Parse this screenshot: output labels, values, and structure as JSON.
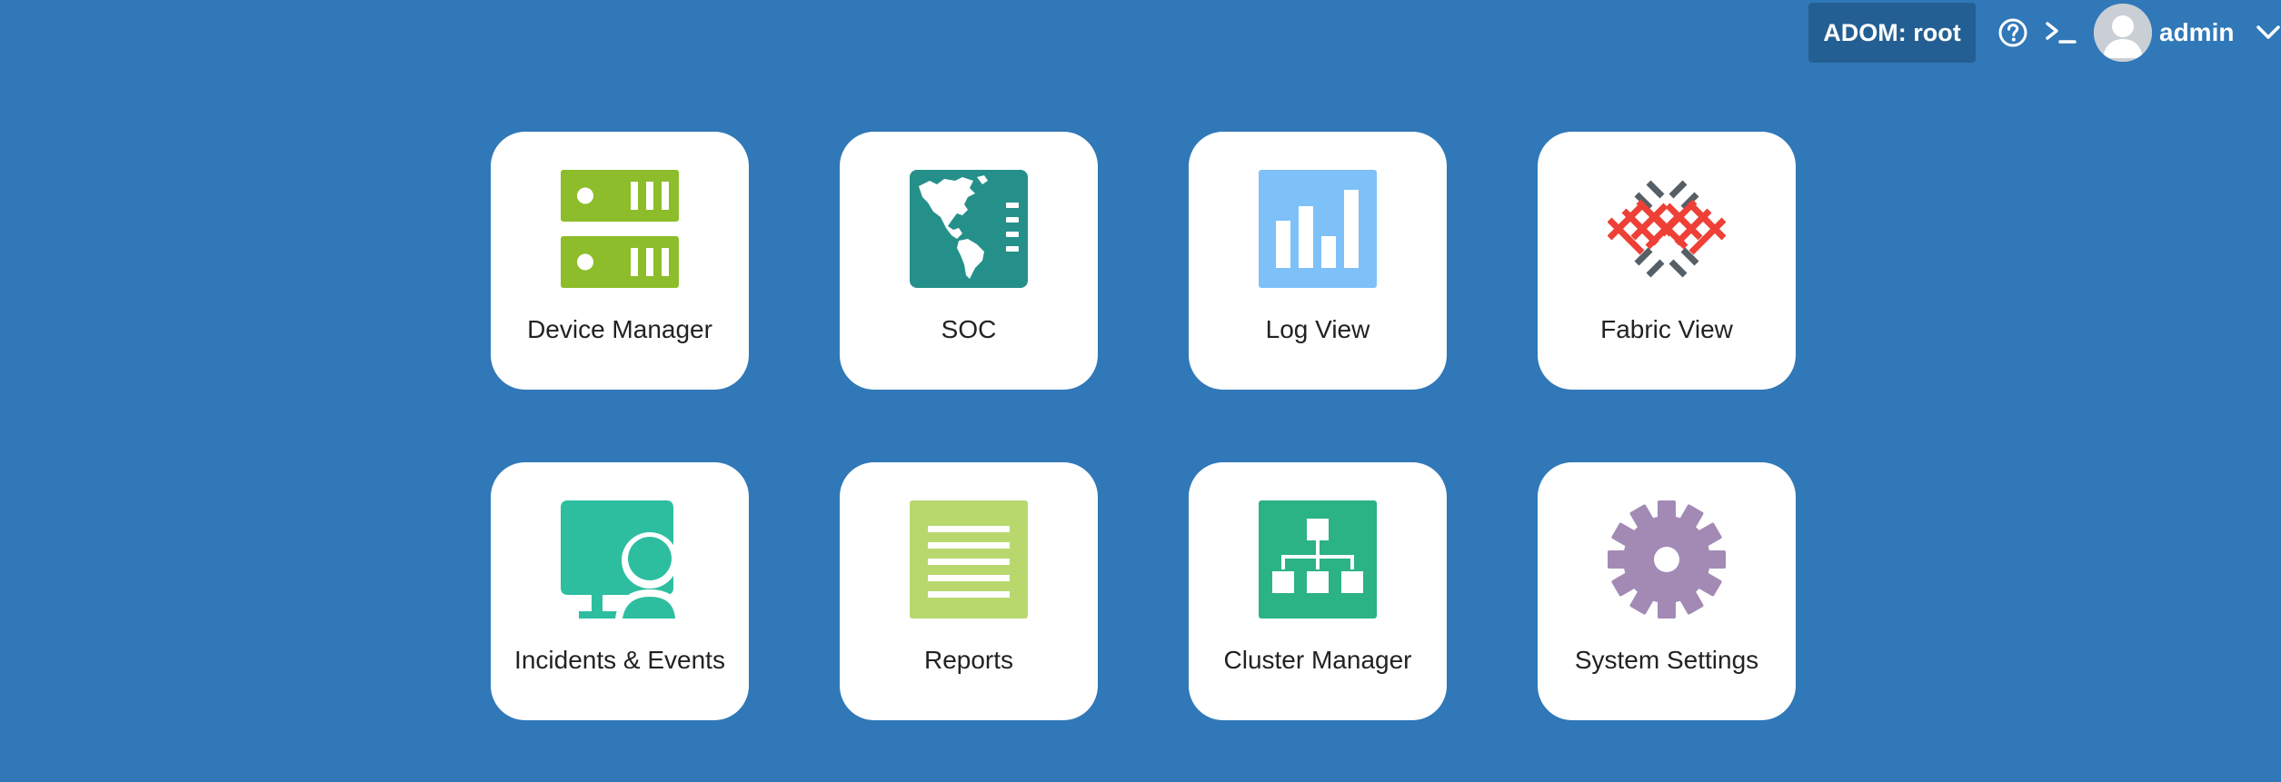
{
  "header": {
    "adom_label": "ADOM: root",
    "username": "admin",
    "icons": {
      "help": "help-circle-icon",
      "console": "terminal-icon",
      "avatar": "user-avatar-icon",
      "menu": "chevron-down-icon"
    }
  },
  "tiles": [
    {
      "label": "Device Manager",
      "icon": "device-manager-icon",
      "color": "#8dbd2a"
    },
    {
      "label": "SOC",
      "icon": "soc-globe-icon",
      "color": "#25908a"
    },
    {
      "label": "Log View",
      "icon": "log-view-chart-icon",
      "color": "#7ec0f8"
    },
    {
      "label": "Fabric View",
      "icon": "fabric-view-icon",
      "color": "#ee4036"
    },
    {
      "label": "Incidents & Events",
      "icon": "incidents-events-icon",
      "color": "#2dbea0"
    },
    {
      "label": "Reports",
      "icon": "reports-icon",
      "color": "#b8d86e"
    },
    {
      "label": "Cluster Manager",
      "icon": "cluster-manager-icon",
      "color": "#2bb386"
    },
    {
      "label": "System Settings",
      "icon": "system-settings-gear-icon",
      "color": "#a28ab5"
    }
  ],
  "colors": {
    "background": "#3078b8",
    "adom_badge": "#245f94",
    "tile": "#ffffff"
  }
}
